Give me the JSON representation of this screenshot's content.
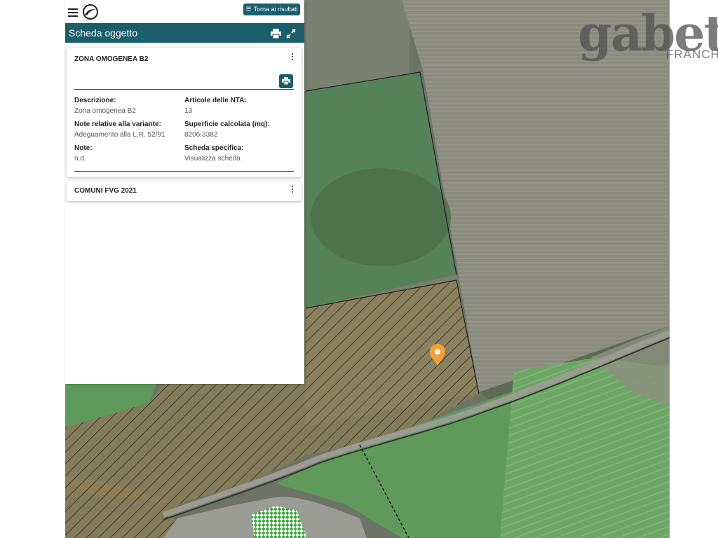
{
  "app": {
    "back_button_label": "Torna ai risultati",
    "back_button_icon": "list-icon"
  },
  "header": {
    "title": "Scheda oggetto",
    "icons": [
      "print-icon",
      "expand-icon"
    ],
    "color": "#1a5e6a"
  },
  "cards": [
    {
      "title": "ZONA OMOGENEA B2",
      "fields": {
        "descrizione_label": "Descrizione:",
        "descrizione_value": "Zona omogenea B2",
        "articolo_label": "Articole delle NTA:",
        "articolo_value": "13",
        "note_variante_label": "Note relative alla variante:",
        "note_variante_value": "Adeguamento alla L.R. 52/91",
        "superficie_label": "Superficie calcolata (mq):",
        "superficie_value": "8206.3382",
        "note_label": "Note:",
        "note_value": "n.d.",
        "scheda_label": "Scheda specifica:",
        "scheda_value": "Visualizza scheda"
      }
    },
    {
      "title": "COMUNI FVG 2021"
    }
  ],
  "watermark": {
    "logo_text": "gabett",
    "subtitle": "FRANCHIS"
  },
  "map": {
    "marker_color": "#f5a13a",
    "hatch_zone_color": "#8a7d52",
    "green_zone_color": "#7fbf7a"
  }
}
